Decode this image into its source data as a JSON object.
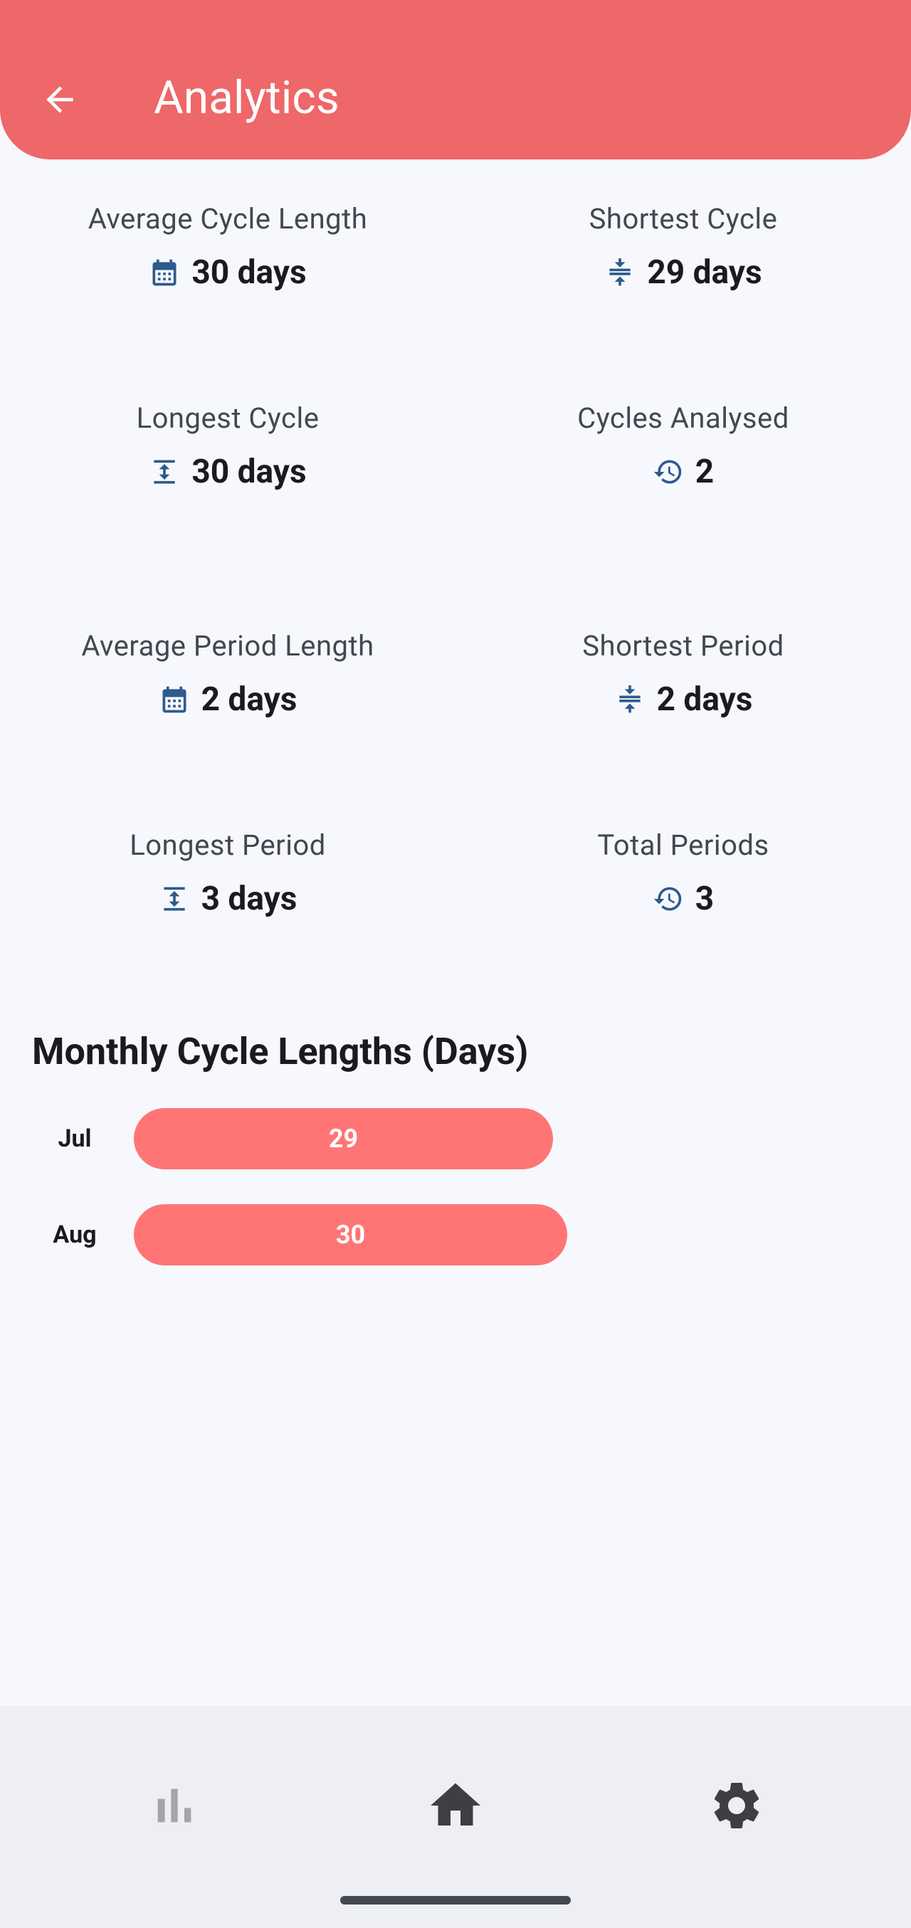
{
  "header": {
    "title": "Analytics",
    "back_icon": "arrow-left-icon"
  },
  "cycle_stats": [
    {
      "label": "Average Cycle Length",
      "value": "30 days",
      "icon": "calendar-icon"
    },
    {
      "label": "Shortest Cycle",
      "value": "29 days",
      "icon": "compress-vertical-icon"
    },
    {
      "label": "Longest Cycle",
      "value": "30 days",
      "icon": "expand-vertical-icon"
    },
    {
      "label": "Cycles Analysed",
      "value": "2",
      "icon": "history-icon"
    }
  ],
  "period_stats": [
    {
      "label": "Average Period Length",
      "value": "2 days",
      "icon": "calendar-icon"
    },
    {
      "label": "Shortest Period",
      "value": "2 days",
      "icon": "compress-vertical-icon"
    },
    {
      "label": "Longest Period",
      "value": "3 days",
      "icon": "expand-vertical-icon"
    },
    {
      "label": "Total Periods",
      "value": "3",
      "icon": "history-icon"
    }
  ],
  "chart_data": {
    "type": "bar",
    "orientation": "horizontal",
    "title": "Monthly Cycle Lengths (Days)",
    "categories": [
      "Jul",
      "Aug"
    ],
    "values": [
      29,
      30
    ],
    "value_labels": [
      "29",
      "30"
    ],
    "color": "#ff7575"
  },
  "bottom_nav": {
    "items": [
      {
        "icon": "bar-chart-icon",
        "active": false
      },
      {
        "icon": "home-icon",
        "active": true
      },
      {
        "icon": "gear-icon",
        "active": false
      }
    ]
  },
  "colors": {
    "accent": "#ee6769",
    "bar": "#ff7575",
    "icon_blue": "#2e5a8c",
    "background": "#f7f8fd",
    "nav_background": "#eeeff4"
  }
}
